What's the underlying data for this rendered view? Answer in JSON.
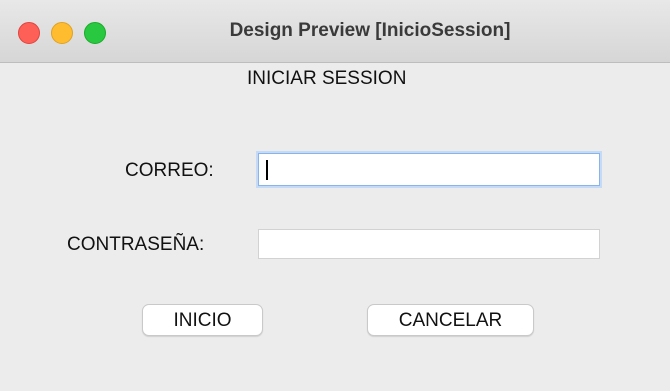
{
  "window": {
    "title": "Design Preview [InicioSession]",
    "top_fragment": "... ......."
  },
  "form": {
    "heading": "INICIAR SESSION",
    "email_label": "CORREO:",
    "email_value": "",
    "password_label": "CONTRASEÑA:",
    "password_value": ""
  },
  "buttons": {
    "login": "INICIO",
    "cancel": "CANCELAR"
  },
  "colors": {
    "close": "#fe5f57",
    "minimize": "#febc2e",
    "zoom": "#28c840",
    "focus_ring": "#8cb3e8"
  }
}
